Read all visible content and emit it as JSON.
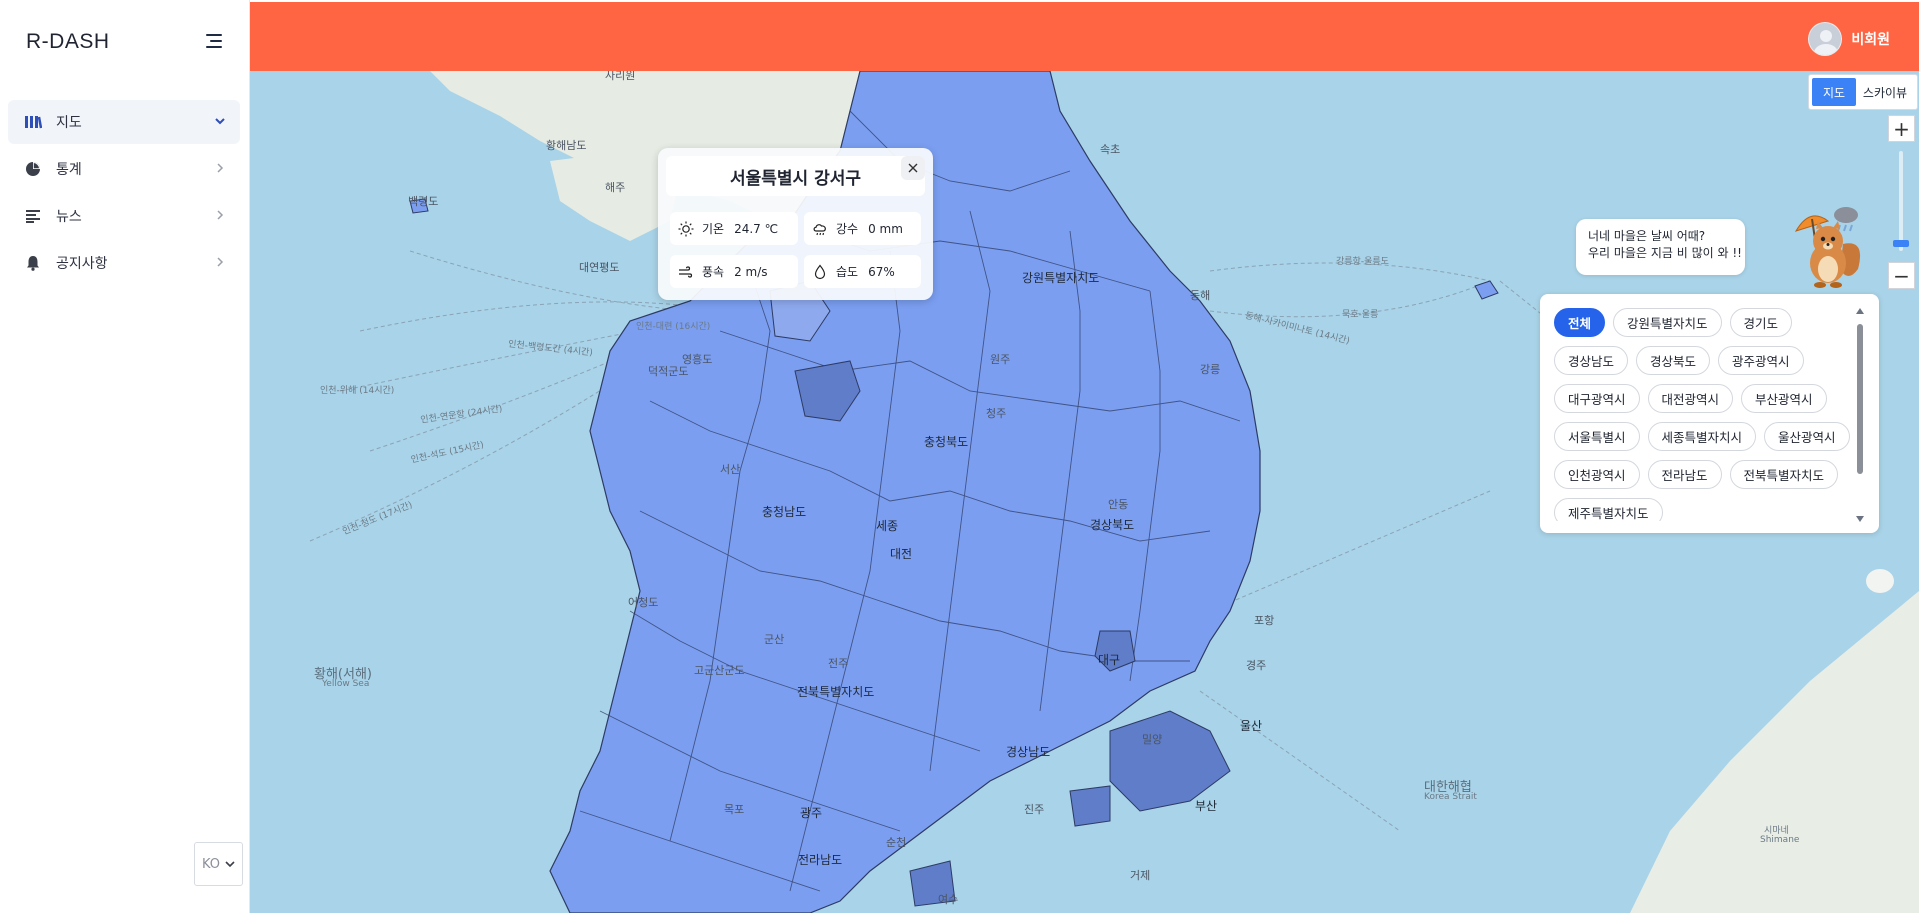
{
  "app": {
    "brand": "R-DASH"
  },
  "sidebar": {
    "items": [
      {
        "label": "지도",
        "icon": "map-icon",
        "active": true
      },
      {
        "label": "통계",
        "icon": "pie-chart-icon",
        "active": false
      },
      {
        "label": "뉴스",
        "icon": "news-icon",
        "active": false
      },
      {
        "label": "공지사항",
        "icon": "bell-icon",
        "active": false
      }
    ],
    "language": "KO"
  },
  "header": {
    "user_name": "비회원",
    "color": "#ff6543"
  },
  "view_toggle": {
    "map": "지도",
    "sky": "스카이뷰"
  },
  "zoom": {
    "in": "+",
    "out": "−"
  },
  "map_labels": {
    "hwanghae_do": "황해남도",
    "haeju": "해주",
    "sariwon": "사리원",
    "yeonpyeong": "대연평도",
    "baengnyeong": "백령도",
    "yellow_sea": "황해(서해)",
    "yellow_sea_en": "Yellow Sea",
    "korea_strait": "대한해협",
    "korea_strait_en": "Korea Strait",
    "shimane": "시마네",
    "shimane_en": "Shimane",
    "sokcho": "속초",
    "donghae": "동해",
    "gangwon": "강원특별자치도",
    "chungbuk": "충청북도",
    "chungnam": "충청남도",
    "gyeongbuk": "경상북도",
    "gyeongnam": "경상남도",
    "jeonbuk": "전북특별자치도",
    "jeonnam": "전라남도",
    "busan": "부산",
    "ulsan": "울산",
    "daegu": "대구",
    "daejeon": "대전",
    "gwangju": "광주",
    "sejong": "세종",
    "eocheongdo": "어청도",
    "gogunsan": "고군산군도",
    "route1": "인천-대련 (16시간)",
    "route2": "인천-백령도간 (4시간)",
    "route3": "인천-위해 (14시간)",
    "route4": "인천-연운항 (24시간)",
    "route5": "인천-석도 (15시간)",
    "route6": "인천-청도 (17시간)",
    "route7": "강릉항-울릉도",
    "route8": "묵호-울릉",
    "route9": "동해-사카이미나토 (14시간)",
    "deokjeokdo": "덕적군도",
    "yeongheung": "영흥도",
    "geoje": "거제",
    "yeosu": "여수",
    "miryang": "밀양",
    "pohang": "포항",
    "gyeongju": "경주",
    "andong": "안동",
    "gangneung": "강릉",
    "wonju": "원주",
    "cheongju": "청주",
    "seosan": "서산",
    "gunsan": "군산",
    "jeonju": "전주",
    "mokpo": "목포",
    "suncheon": "순천",
    "jinju": "진주"
  },
  "popup": {
    "title": "서울특별시 강서구",
    "temp_label": "기온",
    "temp_value": "24.7 ℃",
    "rain_label": "강수",
    "rain_value": "0 mm",
    "wind_label": "풍속",
    "wind_value": "2 m/s",
    "humidity_label": "습도",
    "humidity_value": "67%"
  },
  "bubble": {
    "line1": "너네 마을은 날씨 어때?",
    "line2": "우리 마을은 지금 비 많이 와 !!"
  },
  "regions": {
    "chips": [
      {
        "label": "전체",
        "selected": true
      },
      {
        "label": "강원특별자치도",
        "selected": false
      },
      {
        "label": "경기도",
        "selected": false
      },
      {
        "label": "경상남도",
        "selected": false
      },
      {
        "label": "경상북도",
        "selected": false
      },
      {
        "label": "광주광역시",
        "selected": false
      },
      {
        "label": "대구광역시",
        "selected": false
      },
      {
        "label": "대전광역시",
        "selected": false
      },
      {
        "label": "부산광역시",
        "selected": false
      },
      {
        "label": "서울특별시",
        "selected": false
      },
      {
        "label": "세종특별자치시",
        "selected": false
      },
      {
        "label": "울산광역시",
        "selected": false
      },
      {
        "label": "인천광역시",
        "selected": false
      },
      {
        "label": "전라남도",
        "selected": false
      },
      {
        "label": "전북특별자치도",
        "selected": false
      },
      {
        "label": "제주특별자치도",
        "selected": false
      }
    ]
  },
  "colors": {
    "accent": "#3b82f6",
    "region_fill": "#7b9ef0",
    "sea": "#a9d3e8",
    "land": "#e4ebe3"
  }
}
